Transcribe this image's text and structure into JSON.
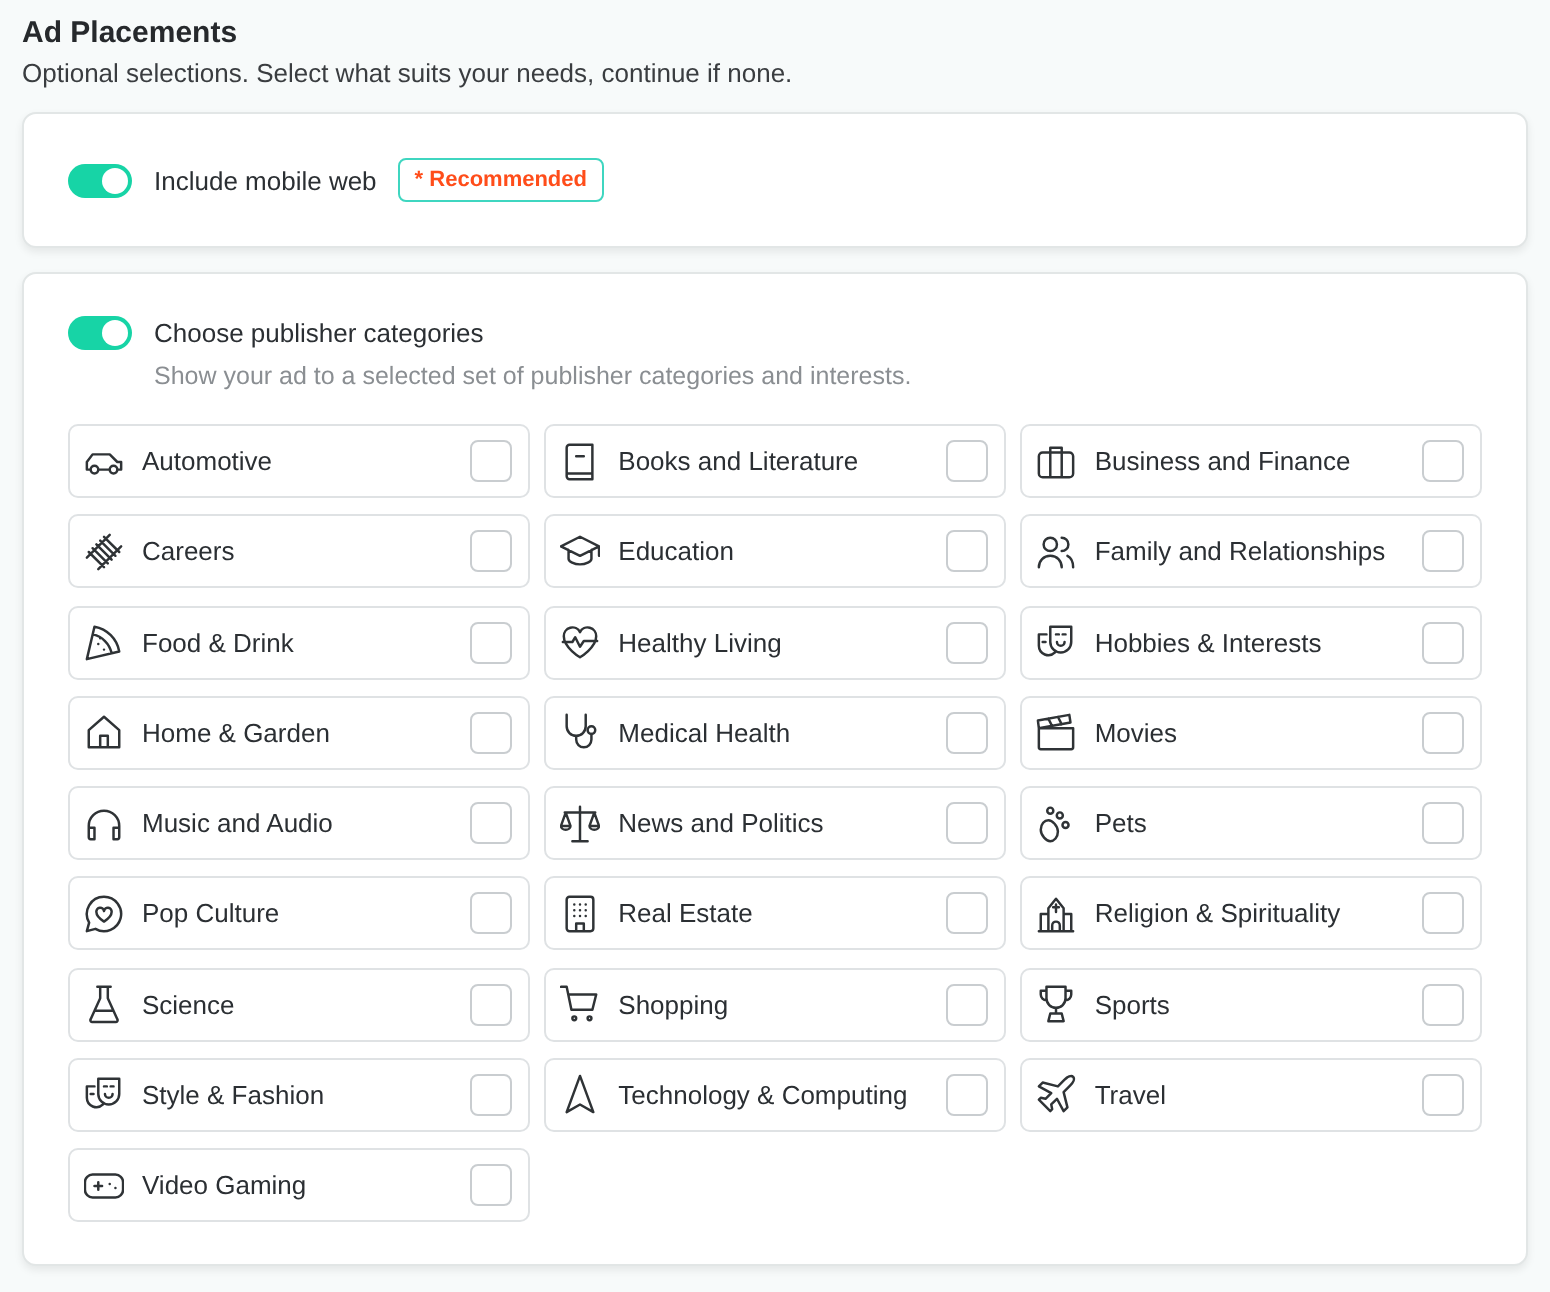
{
  "title": "Ad Placements",
  "subtitle": "Optional selections. Select what suits your needs, continue if none.",
  "mobile_web": {
    "label": "Include mobile web",
    "on": true,
    "badge": "* Recommended"
  },
  "publisher_categories": {
    "label": "Choose publisher categories",
    "on": true,
    "description": "Show your ad to a selected set of publisher categories and interests.",
    "categories": [
      {
        "label": "Automotive",
        "checked": false
      },
      {
        "label": "Books and Literature",
        "checked": false
      },
      {
        "label": "Business and Finance",
        "checked": false
      },
      {
        "label": "Careers",
        "checked": false
      },
      {
        "label": "Education",
        "checked": false
      },
      {
        "label": "Family and Relationships",
        "checked": false
      },
      {
        "label": "Food & Drink",
        "checked": false
      },
      {
        "label": "Healthy Living",
        "checked": false
      },
      {
        "label": "Hobbies & Interests",
        "checked": false
      },
      {
        "label": "Home & Garden",
        "checked": false
      },
      {
        "label": "Medical Health",
        "checked": false
      },
      {
        "label": "Movies",
        "checked": false
      },
      {
        "label": "Music and Audio",
        "checked": false
      },
      {
        "label": "News and Politics",
        "checked": false
      },
      {
        "label": "Pets",
        "checked": false
      },
      {
        "label": "Pop Culture",
        "checked": false
      },
      {
        "label": "Real Estate",
        "checked": false
      },
      {
        "label": "Religion & Spirituality",
        "checked": false
      },
      {
        "label": "Science",
        "checked": false
      },
      {
        "label": "Shopping",
        "checked": false
      },
      {
        "label": "Sports",
        "checked": false
      },
      {
        "label": "Style & Fashion",
        "checked": false
      },
      {
        "label": "Technology & Computing",
        "checked": false
      },
      {
        "label": "Travel",
        "checked": false
      },
      {
        "label": "Video Gaming",
        "checked": false
      }
    ]
  }
}
